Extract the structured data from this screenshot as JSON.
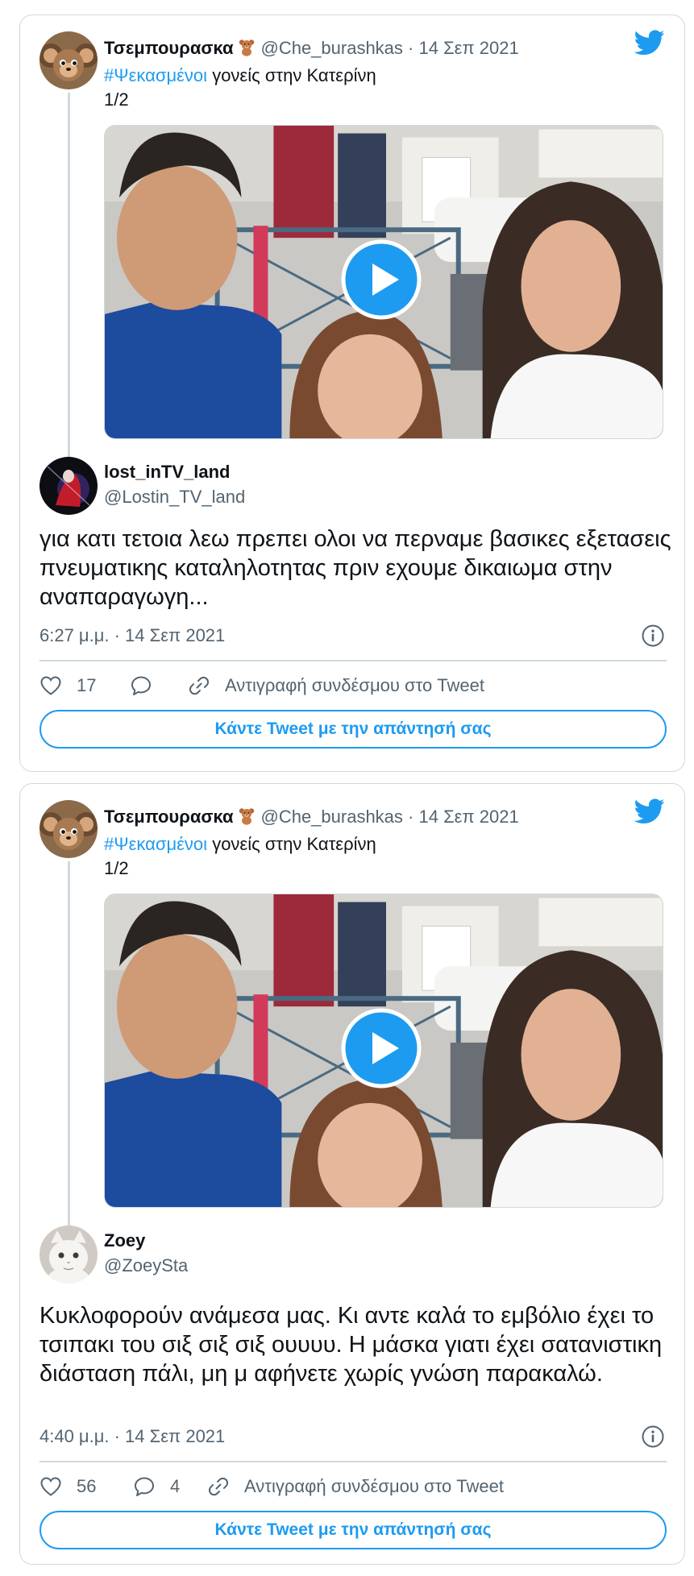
{
  "tweets": [
    {
      "quoted": {
        "author_name": "Τσεμπουρασκα",
        "author_emoji": "teddy-bear",
        "handle": "@Che_burashkas",
        "sep": "·",
        "date": "14 Σεπ 2021",
        "hashtag": "#Ψεκασμένοι",
        "text": "γονείς στην Κατερίνη",
        "counter": "1/2"
      },
      "reply": {
        "author_name": "lost_inTV_land",
        "handle": "@Lostin_TV_land",
        "text": "για κατι τετοια λεω πρεπει ολοι να περναμε βασικες εξετασεις πνευματικης καταληλοτητας πριν εχουμε δικαιωμα στην αναπαραγωγη...",
        "timestamp": "6:27 μ.μ. · 14 Σεπ 2021",
        "likes": "17",
        "replies": "",
        "copy_link": "Αντιγραφή συνδέσμου στο Tweet",
        "cta": "Κάντε Tweet με την απάντησή σας"
      }
    },
    {
      "quoted": {
        "author_name": "Τσεμπουρασκα",
        "author_emoji": "teddy-bear",
        "handle": "@Che_burashkas",
        "sep": "·",
        "date": "14 Σεπ 2021",
        "hashtag": "#Ψεκασμένοι",
        "text": "γονείς στην Κατερίνη",
        "counter": "1/2"
      },
      "reply": {
        "author_name": "Zoey",
        "handle": "@ZoeySta",
        "text": "Κυκλοφορούν ανάμεσα μας. Κι αντε καλά το εμβόλιο έχει το τσιπακι του σιξ σιξ σιξ ουυυυ. Η μάσκα γιατι έχει σατανιστικη διάσταση πάλι, μη μ αφήνετε χωρίς γνώση παρακαλώ.",
        "timestamp": "4:40 μ.μ. · 14 Σεπ 2021",
        "likes": "56",
        "replies": "4",
        "copy_link": "Αντιγραφή συνδέσμου στο Tweet",
        "cta": "Κάντε Tweet με την απάντησή σας"
      }
    }
  ],
  "colors": {
    "accent": "#1d9bf0",
    "text": "#0f1419",
    "muted": "#536471",
    "border": "#cfd9de"
  },
  "icons": [
    "twitter-bird-icon",
    "play-icon",
    "info-icon",
    "heart-icon",
    "reply-icon",
    "link-icon",
    "teddy-bear-emoji"
  ]
}
